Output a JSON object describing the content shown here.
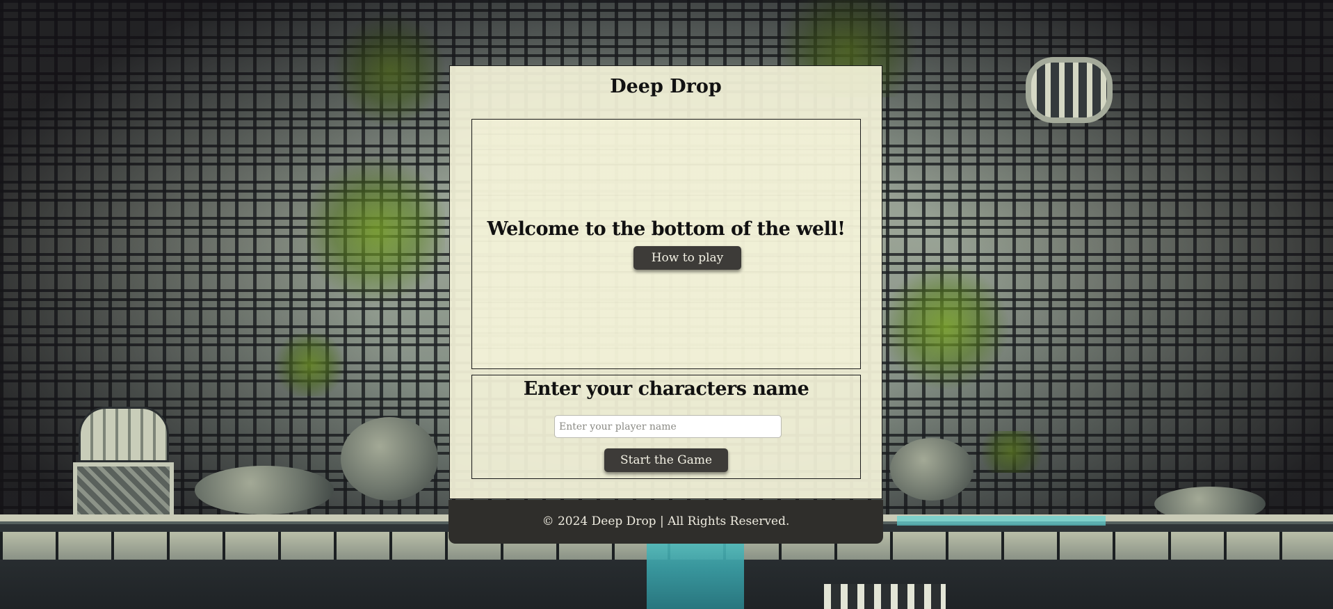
{
  "app": {
    "title": "Deep Drop"
  },
  "welcome": {
    "heading": "Welcome to the bottom of the well!",
    "how_to_play_label": "How to play"
  },
  "character": {
    "heading": "Enter your characters name",
    "name_input_placeholder": "Enter your player name",
    "name_input_value": "",
    "start_label": "Start the Game"
  },
  "footer": {
    "text": "© 2024 Deep Drop | All Rights Reserved."
  },
  "colors": {
    "panel_background": "#f3f2d8",
    "button_background": "#3d3b38",
    "button_text": "#f3f1e4",
    "footer_background": "#2f2e2b"
  },
  "icons": [
    "barred-window-icon",
    "treasure-chest-icon",
    "drain-grate-icon"
  ]
}
